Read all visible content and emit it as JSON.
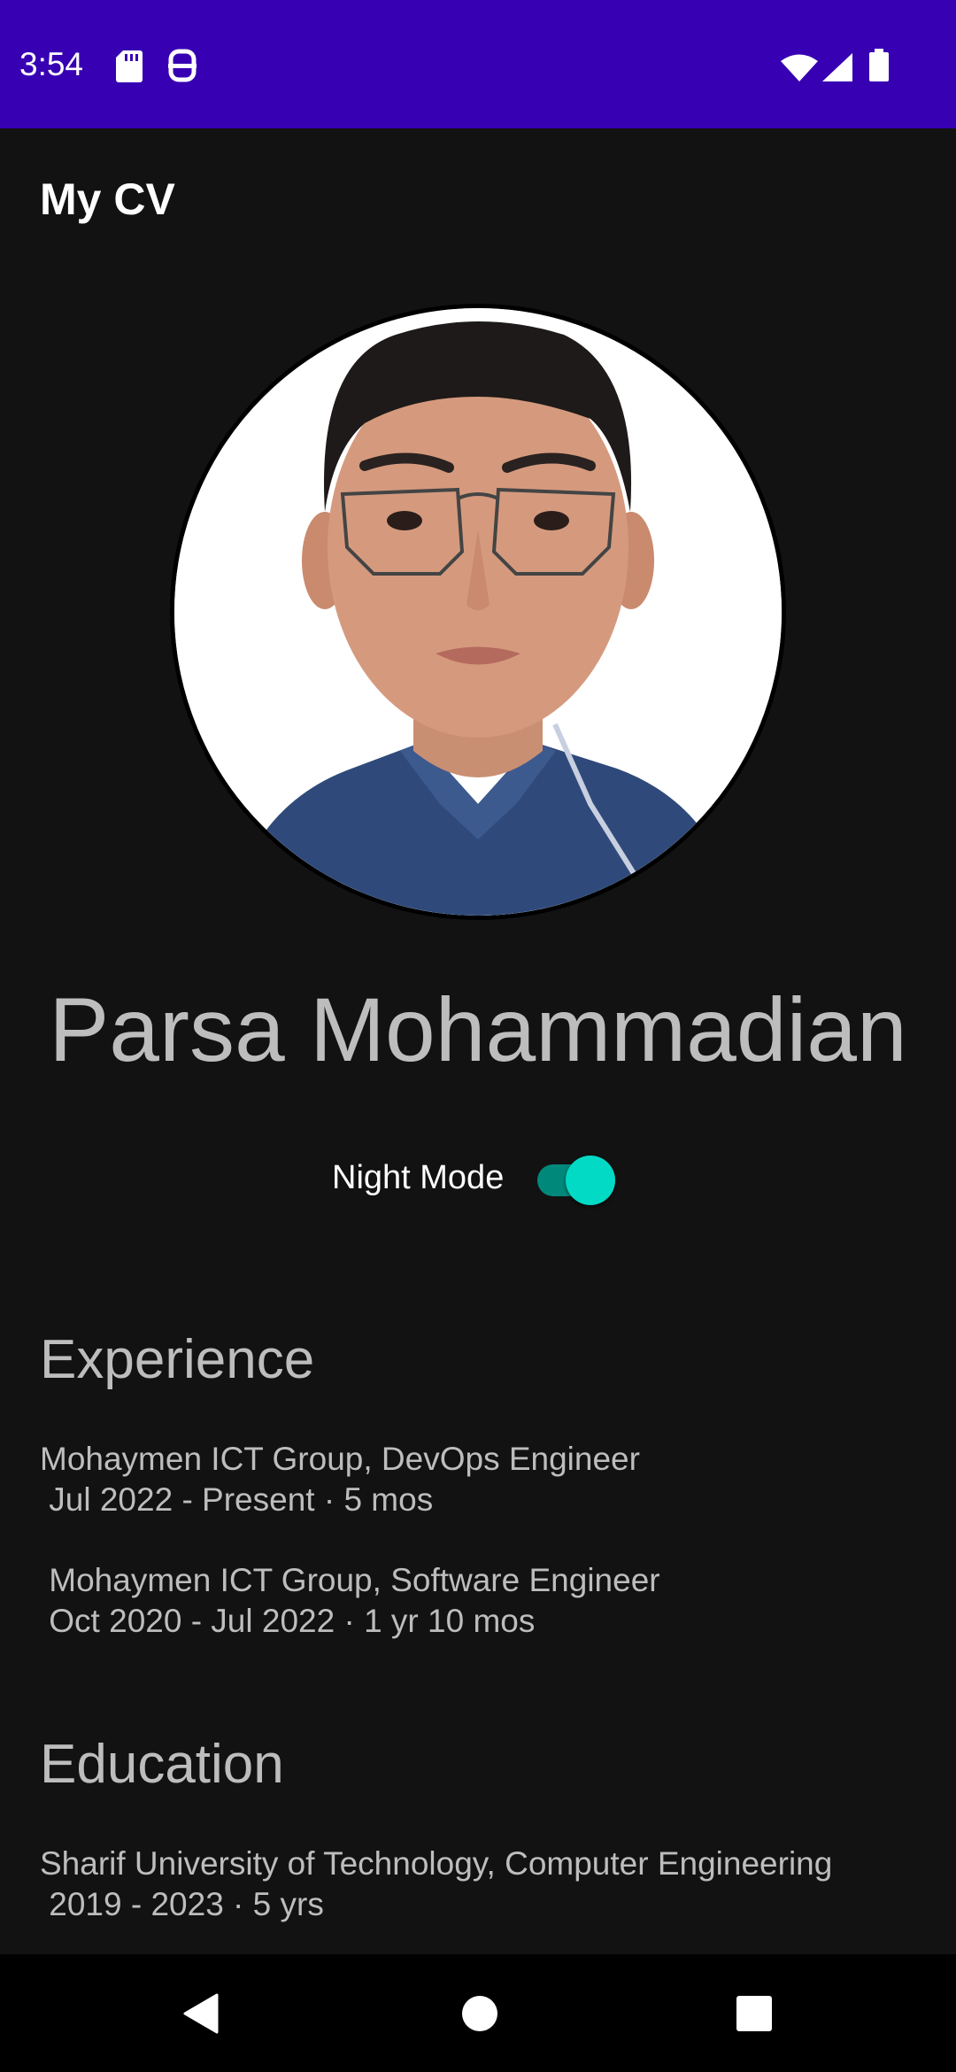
{
  "status_bar": {
    "time": "3:54",
    "icons": [
      "sd-card-icon",
      "assistant-icon",
      "wifi-icon",
      "signal-icon",
      "battery-icon"
    ],
    "background": "#3700b3"
  },
  "app_bar": {
    "title": "My CV"
  },
  "profile": {
    "name": "Parsa Mohammadian",
    "photo": "profile-photo"
  },
  "night_mode": {
    "label": "Night Mode",
    "enabled": true,
    "accent": "#03dac5"
  },
  "experience": {
    "heading": "Experience",
    "entries": [
      {
        "title": "Mohaymen ICT Group, DevOps Engineer",
        "period": " Jul 2022 - Present · 5 mos"
      },
      {
        "title": " Mohaymen ICT Group, Software Engineer",
        "period": " Oct 2020 - Jul 2022 · 1 yr 10 mos"
      }
    ]
  },
  "education": {
    "heading": "Education",
    "entries": [
      {
        "title": "Sharif University of Technology, Computer Engineering",
        "period": " 2019 - 2023 · 5 yrs"
      }
    ]
  },
  "nav_bar": {
    "buttons": [
      "back-icon",
      "home-icon",
      "recents-icon"
    ]
  }
}
